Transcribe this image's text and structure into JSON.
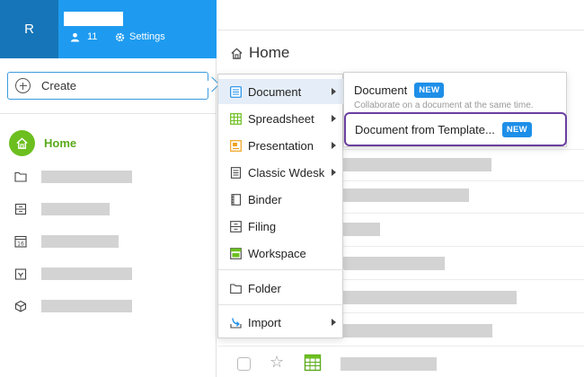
{
  "user": {
    "avatar_initial": "R",
    "members_count": "11",
    "settings_label": "Settings"
  },
  "sidebar": {
    "create_label": "Create",
    "home_label": "Home"
  },
  "main": {
    "title": "Home"
  },
  "create_menu": {
    "items": [
      {
        "label": "Document",
        "has_submenu": true,
        "icon": "document-icon"
      },
      {
        "label": "Spreadsheet",
        "has_submenu": true,
        "icon": "spreadsheet-icon"
      },
      {
        "label": "Presentation",
        "has_submenu": true,
        "icon": "presentation-icon"
      },
      {
        "label": "Classic Wdesk",
        "has_submenu": true,
        "icon": "classic-wdesk-icon"
      },
      {
        "label": "Binder",
        "has_submenu": false,
        "icon": "binder-icon"
      },
      {
        "label": "Filing",
        "has_submenu": false,
        "icon": "filing-icon"
      },
      {
        "label": "Workspace",
        "has_submenu": false,
        "icon": "workspace-icon"
      },
      {
        "label": "Folder",
        "has_submenu": false,
        "icon": "folder-icon"
      },
      {
        "label": "Import",
        "has_submenu": true,
        "icon": "import-icon"
      }
    ]
  },
  "document_submenu": {
    "document_label": "Document",
    "document_badge": "NEW",
    "document_desc": "Collaborate on a document at the same time.",
    "template_label": "Document from Template...",
    "template_badge": "NEW"
  },
  "colors": {
    "topbar": "#1e9bf0",
    "avatar_bg": "#1575b8",
    "home_green": "#6cbf1e",
    "badge_blue": "#1e8fe8",
    "highlight_purple": "#6b3fa0"
  }
}
